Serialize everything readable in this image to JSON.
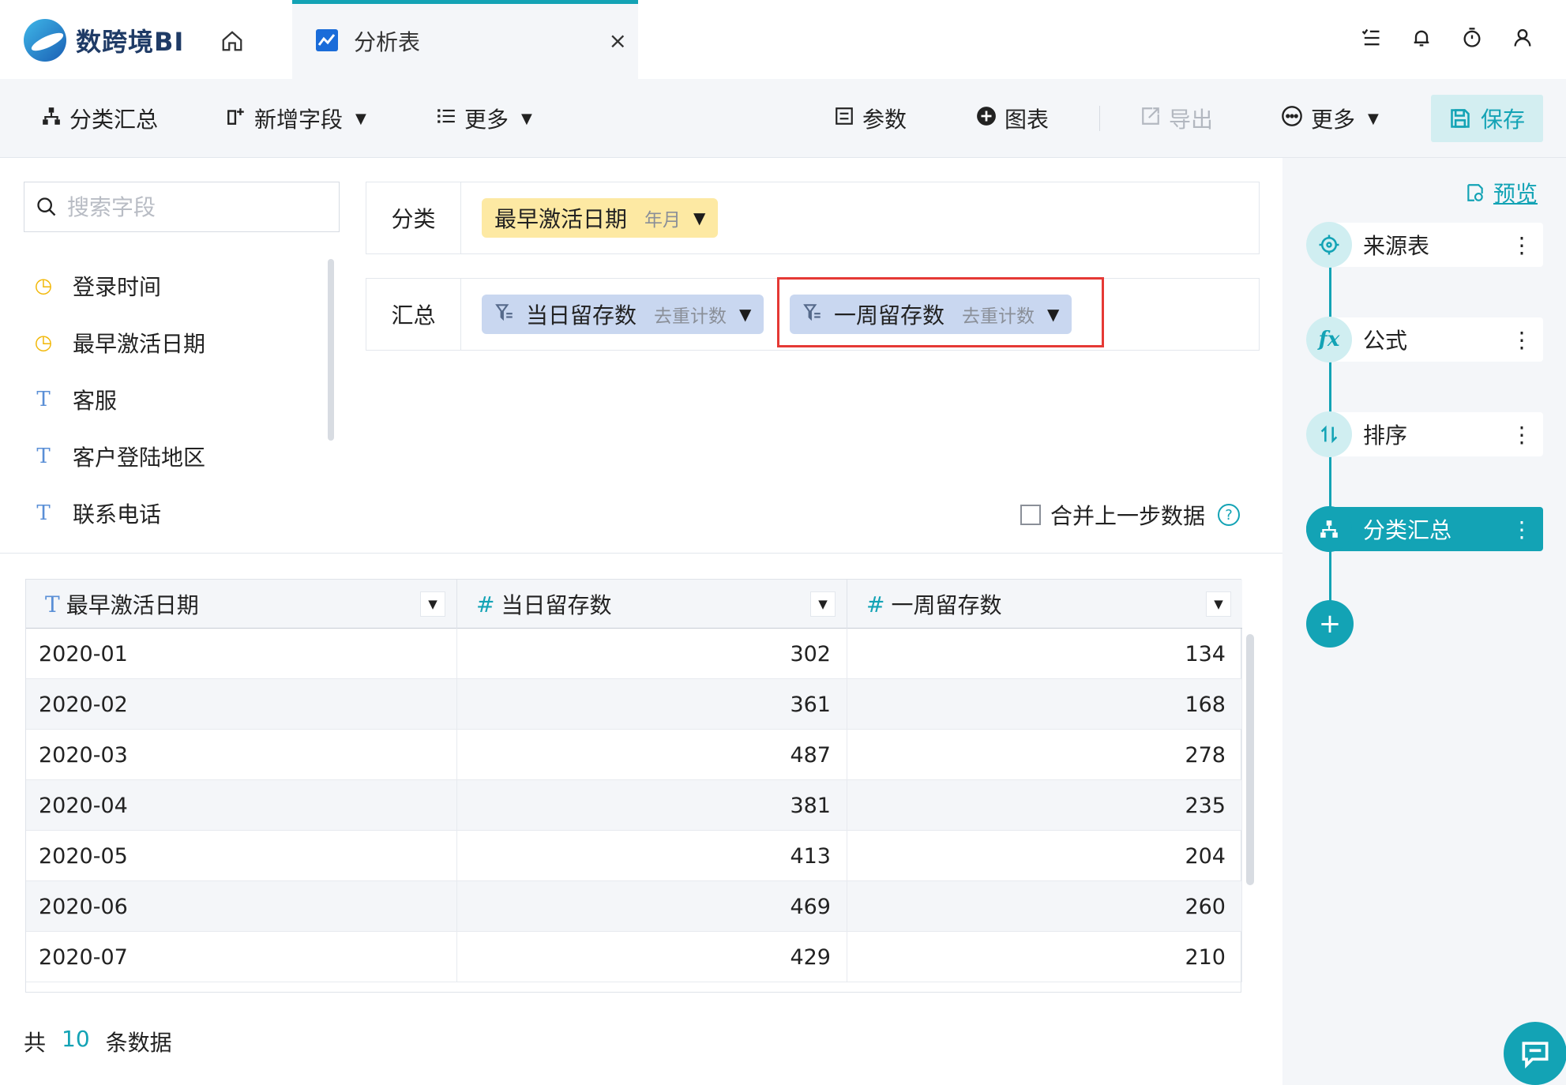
{
  "app": {
    "brand": "数跨境BI"
  },
  "tabs": [
    {
      "label": "分析表",
      "close": "×"
    }
  ],
  "toolbar": {
    "group_summary": "分类汇总",
    "add_field": "新增字段",
    "more_left": "更多",
    "params": "参数",
    "chart": "图表",
    "export": "导出",
    "more_right": "更多",
    "save": "保存"
  },
  "left_panel": {
    "search_placeholder": "搜索字段",
    "fields": [
      {
        "type": "time",
        "name": "登录时间"
      },
      {
        "type": "time",
        "name": "最早激活日期"
      },
      {
        "type": "text",
        "name": "客服"
      },
      {
        "type": "text",
        "name": "客户登陆地区"
      },
      {
        "type": "text",
        "name": "联系电话"
      }
    ]
  },
  "config": {
    "group_label": "分类",
    "group_pill": {
      "name": "最早激活日期",
      "sub": "年月"
    },
    "summary_label": "汇总",
    "summary_pills": [
      {
        "name": "当日留存数",
        "sub": "去重计数"
      },
      {
        "name": "一周留存数",
        "sub": "去重计数"
      }
    ],
    "merge_label": "合并上一步数据",
    "help": "?"
  },
  "table": {
    "columns": [
      {
        "type": "T",
        "name": "最早激活日期"
      },
      {
        "type": "#",
        "name": "当日留存数"
      },
      {
        "type": "#",
        "name": "一周留存数"
      }
    ],
    "rows": [
      [
        "2020-01",
        "302",
        "134"
      ],
      [
        "2020-02",
        "361",
        "168"
      ],
      [
        "2020-03",
        "487",
        "278"
      ],
      [
        "2020-04",
        "381",
        "235"
      ],
      [
        "2020-05",
        "413",
        "204"
      ],
      [
        "2020-06",
        "469",
        "260"
      ],
      [
        "2020-07",
        "429",
        "210"
      ]
    ],
    "total_prefix": "共",
    "total_count": "10",
    "total_suffix": "条数据"
  },
  "flow": {
    "preview": "预览",
    "steps": [
      {
        "label": "来源表",
        "icon": "crosshair-icon",
        "active": false
      },
      {
        "label": "公式",
        "icon": "fx-icon",
        "active": false
      },
      {
        "label": "排序",
        "icon": "sort-icon",
        "active": false
      },
      {
        "label": "分类汇总",
        "icon": "hierarchy-icon",
        "active": true
      }
    ],
    "add": "+"
  },
  "colors": {
    "accent": "#13a3b5",
    "highlight": "#e53935",
    "yellow_pill": "#fde9a3",
    "blue_pill": "#c9d7f0"
  }
}
